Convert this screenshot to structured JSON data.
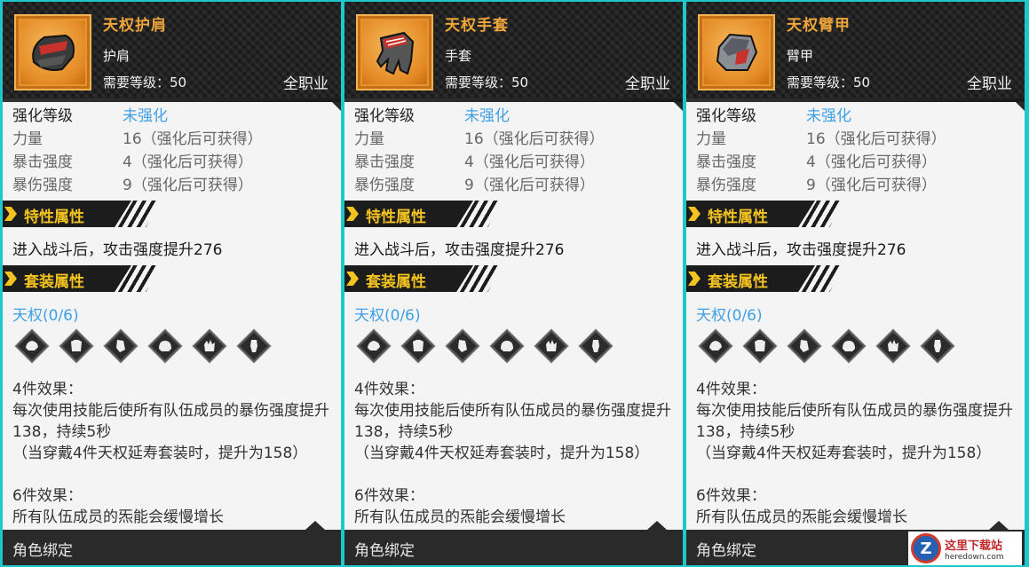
{
  "panels": [
    {
      "item_name": "天权护肩",
      "item_type": "护肩",
      "level_req": "需要等级：50",
      "job": "全职业",
      "stats": [
        {
          "label": "强化等级",
          "value": "未强化"
        },
        {
          "label": "力量",
          "value": "16（强化后可获得）"
        },
        {
          "label": "暴击强度",
          "value": "4（强化后可获得）"
        },
        {
          "label": "暴伤强度",
          "value": "9（强化后可获得）"
        }
      ],
      "trait_title": "特性属性",
      "trait_text": "进入战斗后，攻击强度提升276",
      "set_title": "套装属性",
      "set_name": "天权(0/6)",
      "effect4_title": "4件效果：",
      "effect4_text": "每次使用技能后使所有队伍成员的暴伤强度提升138，持续5秒",
      "effect4_note": "（当穿戴4件天权延寿套装时，提升为158）",
      "effect6_title": "6件效果：",
      "effect6_text": "所有队伍成员的炁能会缓慢增长",
      "bind": "角色绑定",
      "icon": "shoulder-armor-icon"
    },
    {
      "item_name": "天权手套",
      "item_type": "手套",
      "level_req": "需要等级：50",
      "job": "全职业",
      "stats": [
        {
          "label": "强化等级",
          "value": "未强化"
        },
        {
          "label": "力量",
          "value": "16（强化后可获得）"
        },
        {
          "label": "暴击强度",
          "value": "4（强化后可获得）"
        },
        {
          "label": "暴伤强度",
          "value": "9（强化后可获得）"
        }
      ],
      "trait_title": "特性属性",
      "trait_text": "进入战斗后，攻击强度提升276",
      "set_title": "套装属性",
      "set_name": "天权(0/6)",
      "effect4_title": "4件效果：",
      "effect4_text": "每次使用技能后使所有队伍成员的暴伤强度提升138，持续5秒",
      "effect4_note": "（当穿戴4件天权延寿套装时，提升为158）",
      "effect6_title": "6件效果：",
      "effect6_text": "所有队伍成员的炁能会缓慢增长",
      "bind": "角色绑定",
      "icon": "glove-icon"
    },
    {
      "item_name": "天权臂甲",
      "item_type": "臂甲",
      "level_req": "需要等级：50",
      "job": "全职业",
      "stats": [
        {
          "label": "强化等级",
          "value": "未强化"
        },
        {
          "label": "力量",
          "value": "16（强化后可获得）"
        },
        {
          "label": "暴击强度",
          "value": "4（强化后可获得）"
        },
        {
          "label": "暴伤强度",
          "value": "9（强化后可获得）"
        }
      ],
      "trait_title": "特性属性",
      "trait_text": "进入战斗后，攻击强度提升276",
      "set_title": "套装属性",
      "set_name": "天权(0/6)",
      "effect4_title": "4件效果：",
      "effect4_text": "每次使用技能后使所有队伍成员的暴伤强度提升138，持续5秒",
      "effect4_note": "（当穿戴4件天权延寿套装时，提升为158）",
      "effect6_title": "6件效果：",
      "effect6_text": "所有队伍成员的炁能会缓慢增长",
      "bind": "角色绑定",
      "icon": "arm-guard-icon"
    }
  ],
  "set_piece_icons": [
    "shoulder-icon",
    "chest-icon",
    "arm-icon",
    "helmet-icon",
    "glove-icon",
    "leg-icon"
  ],
  "watermark": {
    "name": "这里下载站",
    "url": "heredown.com",
    "logo": "Z"
  },
  "colors": {
    "accent_orange": "#e5952e",
    "title_orange": "#f0a63a",
    "section_yellow": "#f3c320",
    "blue": "#3fa0e8",
    "frame": "#1ec7c9"
  }
}
